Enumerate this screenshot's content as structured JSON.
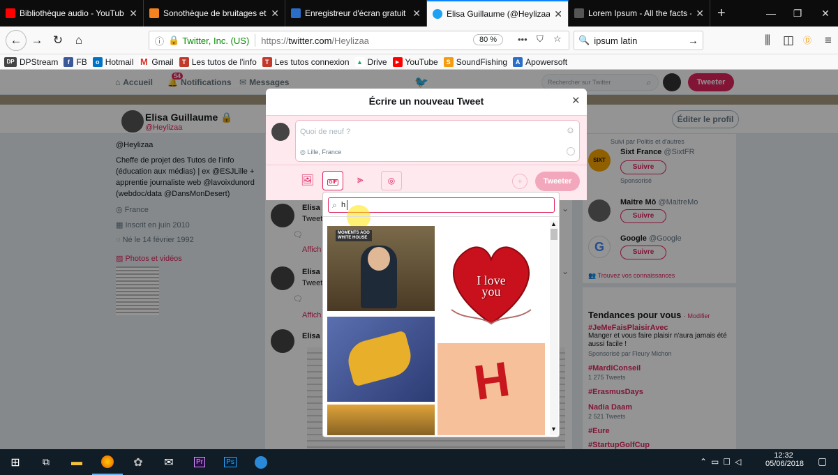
{
  "tabs": [
    {
      "title": "Bibliothèque audio - YouTub",
      "favicon_color": "#ff0000"
    },
    {
      "title": "Sonothèque de bruitages et",
      "favicon_color": "#f5821f"
    },
    {
      "title": "Enregistreur d'écran gratuit",
      "favicon_color": "#2a6ec7"
    },
    {
      "title": "Elisa Guillaume (@Heylizaa) |",
      "favicon_color": "#1da1f2"
    },
    {
      "title": "Lorem Ipsum - All the facts -",
      "favicon_color": "#dddddd"
    }
  ],
  "nav": {
    "identity": "Twitter, Inc. (US)",
    "url_prefix": "https://",
    "url_host": "twitter.com",
    "url_path": "/Heylizaa",
    "zoom": "80 %",
    "search_value": "ipsum latin"
  },
  "bookmarks": [
    {
      "label": "DPStream",
      "icon": "DP",
      "color": "#444444"
    },
    {
      "label": "FB",
      "icon": "f",
      "color": "#3b5998"
    },
    {
      "label": "Hotmail",
      "icon": "o",
      "color": "#0072c6"
    },
    {
      "label": "Gmail",
      "icon": "M",
      "color": "#d93025"
    },
    {
      "label": "Les tutos de l'info",
      "icon": "T",
      "color": "#c0392b"
    },
    {
      "label": "Les tutos connexion",
      "icon": "T",
      "color": "#c0392b"
    },
    {
      "label": "Drive",
      "icon": "▲",
      "color": "#1fa463"
    },
    {
      "label": "YouTube",
      "icon": "▶",
      "color": "#ff0000"
    },
    {
      "label": "SoundFishing",
      "icon": "S",
      "color": "#f39c12"
    },
    {
      "label": "Apowersoft",
      "icon": "A",
      "color": "#2a6ec7"
    }
  ],
  "twitter_nav": {
    "home": "Accueil",
    "notifications": "Notifications",
    "notif_count": "54",
    "messages": "Messages",
    "search_placeholder": "Rechercher sur Twitter",
    "tweet_button": "Tweeter"
  },
  "profile": {
    "name": "Elisa Guillaume",
    "handle": "@Heylizaa",
    "handle2": "@Heylizaa",
    "bio_lines": [
      "Cheffe de projet des Tutos de l'info",
      "(éducation aux médias) | ex @ESJLille +",
      "apprentie journaliste web @lavoixdunord",
      "(webdoc/data @DansMonDesert)"
    ],
    "location": "France",
    "joined": "Inscrit en juin 2010",
    "born": "Né le 14 février 1992",
    "photos": "Photos et vidéos",
    "edit_profile": "Éditer le profil"
  },
  "tweets": [
    {
      "name": "Elisa G",
      "text": "Tweet",
      "more": "Affich"
    },
    {
      "name": "Elisa G",
      "text": "Tweet",
      "more": "Affich"
    },
    {
      "name": "Elisa G",
      "text": ""
    }
  ],
  "who_to_follow": {
    "followed_by": "Suivi par Politis et d'autres",
    "accounts": [
      {
        "name": "Sixt France",
        "handle": "@SixtFR",
        "follow": "Suivre",
        "note": "Sponsorisé"
      },
      {
        "name": "Maitre Mô",
        "handle": "@MaitreMo",
        "follow": "Suivre"
      },
      {
        "name": "Google",
        "handle": "@Google",
        "follow": "Suivre"
      }
    ],
    "find_friends": "Trouvez vos connaissances"
  },
  "trends": {
    "title": "Tendances pour vous",
    "modify": "· Modifier",
    "items": [
      {
        "tag": "#JeMeFaisPlaisirAvec",
        "desc": "Manger et vous faire plaisir n'aura jamais été aussi facile !",
        "meta": "Sponsorisé par Fleury Michon"
      },
      {
        "tag": "#MardiConseil",
        "meta": "1 275 Tweets"
      },
      {
        "tag": "#ErasmusDays"
      },
      {
        "tag": "Nadia Daam",
        "meta": "2 521 Tweets"
      },
      {
        "tag": "#Eure"
      },
      {
        "tag": "#StartupGolfCup"
      }
    ]
  },
  "modal": {
    "title": "Écrire un nouveau Tweet",
    "placeholder": "Quoi de neuf ?",
    "location": "Lille, France",
    "tweet_button": "Tweeter",
    "gif_label": "GIF"
  },
  "gif_search": {
    "query": "h",
    "items": [
      "MOMENTS AGO\nWHITE HOUSE",
      "I love you",
      "",
      "H",
      ""
    ]
  },
  "taskbar": {
    "time": "12:32",
    "date": "05/06/2018"
  }
}
